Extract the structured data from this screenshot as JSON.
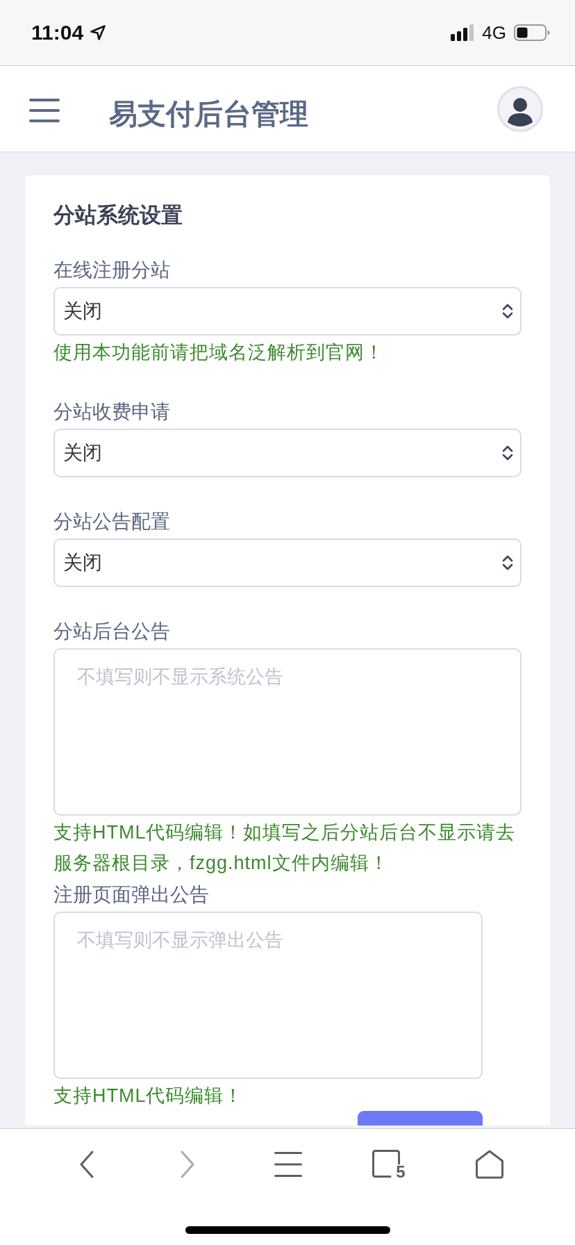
{
  "status_bar": {
    "time": "11:04",
    "network": "4G"
  },
  "header": {
    "title": "易支付后台管理"
  },
  "card": {
    "title": "分站系统设置",
    "fields": [
      {
        "kind": "select",
        "label": "在线注册分站",
        "value": "关闭",
        "help": "使用本功能前请把域名泛解析到官网！"
      },
      {
        "kind": "select",
        "label": "分站收费申请",
        "value": "关闭"
      },
      {
        "kind": "select",
        "label": "分站公告配置",
        "value": "关闭"
      },
      {
        "kind": "textarea",
        "label": "分站后台公告",
        "placeholder": "不填写则不显示系统公告",
        "help": "支持HTML代码编辑！如填写之后分站后台不显示请去服务器根目录，fzgg.html文件内编辑！"
      },
      {
        "kind": "textarea",
        "label": "注册页面弹出公告",
        "placeholder": "不填写则不显示弹出公告",
        "help": "支持HTML代码编辑！"
      }
    ]
  },
  "browser_toolbar": {
    "buttons": [
      {
        "kind": "back",
        "disabled": false
      },
      {
        "kind": "forward",
        "disabled": true
      },
      {
        "kind": "menu",
        "disabled": false
      },
      {
        "kind": "tabs",
        "disabled": false,
        "count": "5"
      },
      {
        "kind": "home",
        "disabled": false
      }
    ]
  }
}
